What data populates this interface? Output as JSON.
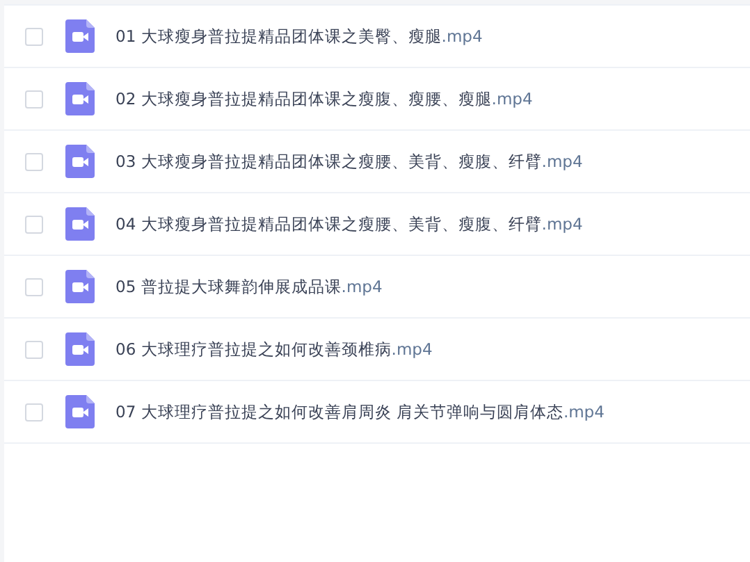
{
  "files": [
    {
      "name": "01 大球瘦身普拉提精品团体课之美臀、瘦腿",
      "ext": ".mp4",
      "checked": false
    },
    {
      "name": "02 大球瘦身普拉提精品团体课之瘦腹、瘦腰、瘦腿",
      "ext": ".mp4",
      "checked": false
    },
    {
      "name": "03 大球瘦身普拉提精品团体课之瘦腰、美背、瘦腹、纤臂",
      "ext": ".mp4",
      "checked": false
    },
    {
      "name": "04 大球瘦身普拉提精品团体课之瘦腰、美背、瘦腹、纤臂",
      "ext": ".mp4",
      "checked": false
    },
    {
      "name": "05 普拉提大球舞韵伸展成品课",
      "ext": ".mp4",
      "checked": false
    },
    {
      "name": "06 大球理疗普拉提之如何改善颈椎病",
      "ext": ".mp4",
      "checked": false
    },
    {
      "name": "07 大球理疗普拉提之如何改善肩周炎 肩关节弹响与圆肩体态",
      "ext": ".mp4",
      "checked": false
    }
  ]
}
